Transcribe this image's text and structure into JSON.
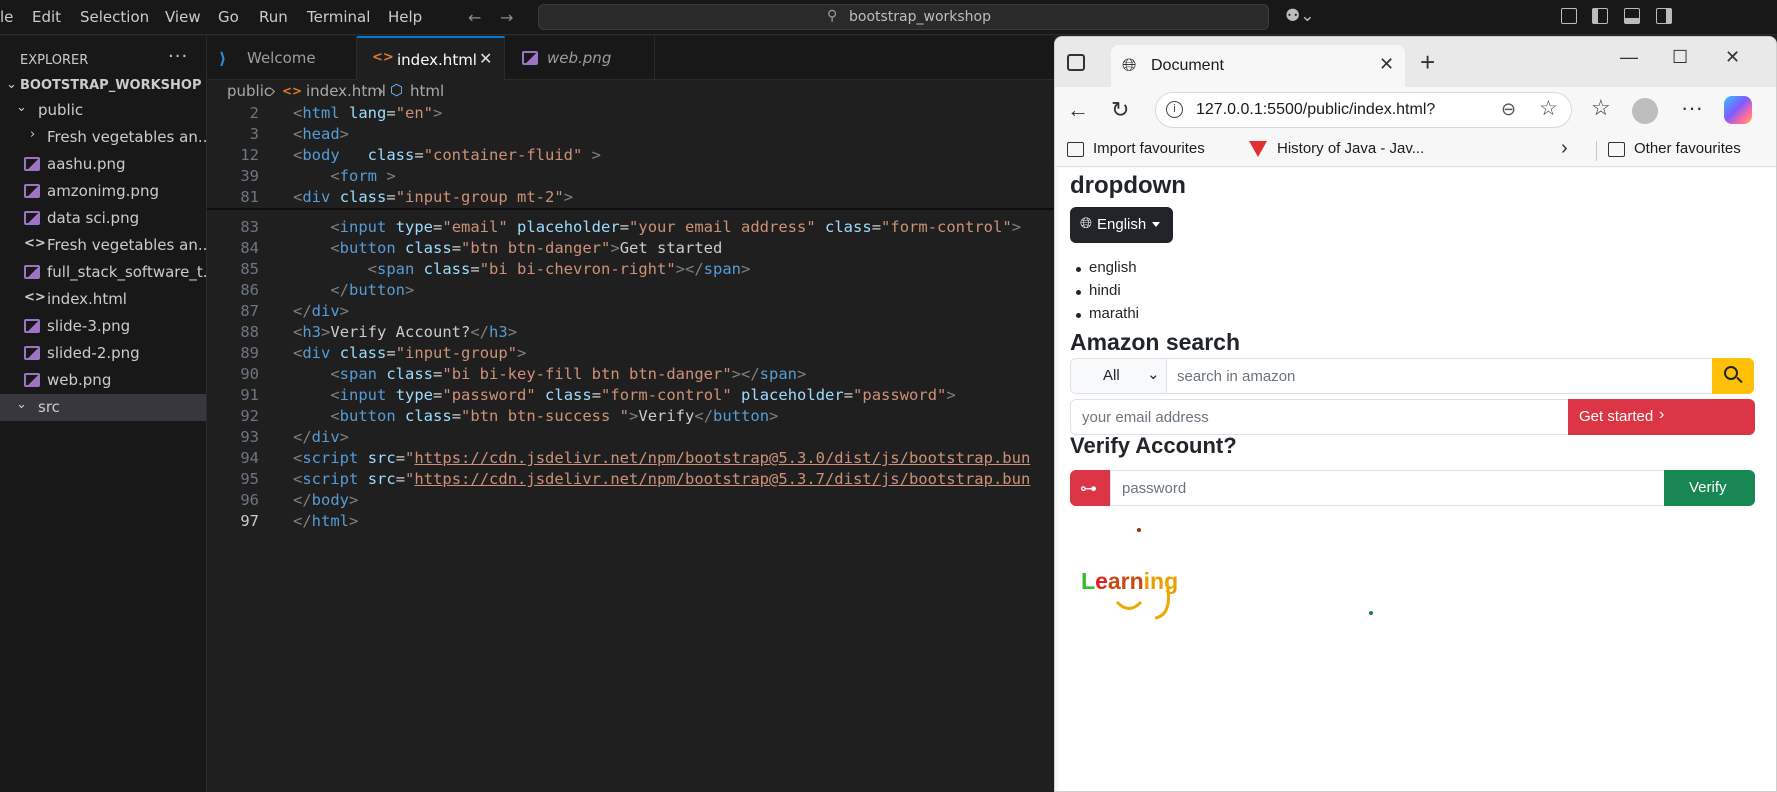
{
  "titlebar": {
    "menu": [
      "le",
      "Edit",
      "Selection",
      "View",
      "Go",
      "Run",
      "Terminal",
      "Help"
    ],
    "search_text": "bootstrap_workshop"
  },
  "explorer": {
    "title": "EXPLORER",
    "more": "···",
    "workspace": "BOOTSTRAP_WORKSHOP",
    "items": [
      {
        "label": "public",
        "kind": "folder-open"
      },
      {
        "label": "Fresh vegetables an...",
        "kind": "folder"
      },
      {
        "label": "aashu.png",
        "kind": "image"
      },
      {
        "label": "amzonimg.png",
        "kind": "image"
      },
      {
        "label": "data sci.png",
        "kind": "image"
      },
      {
        "label": "Fresh vegetables an...",
        "kind": "html"
      },
      {
        "label": "full_stack_software_t...",
        "kind": "image"
      },
      {
        "label": "index.html",
        "kind": "html"
      },
      {
        "label": "slide-3.png",
        "kind": "image"
      },
      {
        "label": "slided-2.png",
        "kind": "image"
      },
      {
        "label": "web.png",
        "kind": "image"
      },
      {
        "label": "src",
        "kind": "folder"
      }
    ]
  },
  "editor": {
    "tabs": [
      {
        "label": "Welcome"
      },
      {
        "label": "index.html"
      },
      {
        "label": "web.png"
      }
    ],
    "breadcrumb": [
      "public",
      "index.html",
      "html"
    ],
    "lines": [
      {
        "n": "2",
        "seg": [
          [
            "t",
            "<"
          ],
          [
            "n",
            "html"
          ],
          [
            "x",
            " "
          ],
          [
            "a",
            "lang"
          ],
          [
            "x",
            "="
          ],
          [
            "s",
            "\"en\""
          ],
          [
            "t",
            ">"
          ]
        ]
      },
      {
        "n": "3",
        "seg": [
          [
            "t",
            "<"
          ],
          [
            "n",
            "head"
          ],
          [
            "t",
            ">"
          ]
        ]
      },
      {
        "n": "12",
        "seg": [
          [
            "t",
            "<"
          ],
          [
            "n",
            "body"
          ],
          [
            "x",
            "   "
          ],
          [
            "a",
            "class"
          ],
          [
            "x",
            "="
          ],
          [
            "s",
            "\"container-fluid\""
          ],
          [
            "x",
            " "
          ],
          [
            "t",
            ">"
          ]
        ]
      },
      {
        "n": "39",
        "seg": [
          [
            "x",
            "    "
          ],
          [
            "t",
            "<"
          ],
          [
            "n",
            "form"
          ],
          [
            "x",
            " "
          ],
          [
            "t",
            ">"
          ]
        ]
      },
      {
        "n": "81",
        "seg": [
          [
            "t",
            "<"
          ],
          [
            "n",
            "div"
          ],
          [
            "x",
            " "
          ],
          [
            "a",
            "class"
          ],
          [
            "x",
            "="
          ],
          [
            "s",
            "\"input-group mt-2\""
          ],
          [
            "t",
            ">"
          ]
        ]
      },
      {
        "n": "83",
        "seg": [
          [
            "x",
            "    "
          ],
          [
            "t",
            "<"
          ],
          [
            "n",
            "input"
          ],
          [
            "x",
            " "
          ],
          [
            "a",
            "type"
          ],
          [
            "x",
            "="
          ],
          [
            "s",
            "\"email\""
          ],
          [
            "x",
            " "
          ],
          [
            "a",
            "placeholder"
          ],
          [
            "x",
            "="
          ],
          [
            "s",
            "\"your email address\""
          ],
          [
            "x",
            " "
          ],
          [
            "a",
            "class"
          ],
          [
            "x",
            "="
          ],
          [
            "s",
            "\"form-control\""
          ],
          [
            "t",
            ">"
          ]
        ]
      },
      {
        "n": "84",
        "seg": [
          [
            "x",
            "    "
          ],
          [
            "t",
            "<"
          ],
          [
            "n",
            "button"
          ],
          [
            "x",
            " "
          ],
          [
            "a",
            "class"
          ],
          [
            "x",
            "="
          ],
          [
            "s",
            "\"btn btn-danger\""
          ],
          [
            "t",
            ">"
          ],
          [
            "x",
            "Get started"
          ]
        ]
      },
      {
        "n": "85",
        "seg": [
          [
            "x",
            "        "
          ],
          [
            "t",
            "<"
          ],
          [
            "n",
            "span"
          ],
          [
            "x",
            " "
          ],
          [
            "a",
            "class"
          ],
          [
            "x",
            "="
          ],
          [
            "s",
            "\"bi bi-chevron-right\""
          ],
          [
            "t",
            "></"
          ],
          [
            "n",
            "span"
          ],
          [
            "t",
            ">"
          ]
        ]
      },
      {
        "n": "86",
        "seg": [
          [
            "x",
            "    "
          ],
          [
            "t",
            "</"
          ],
          [
            "n",
            "button"
          ],
          [
            "t",
            ">"
          ]
        ]
      },
      {
        "n": "87",
        "seg": [
          [
            "t",
            "</"
          ],
          [
            "n",
            "div"
          ],
          [
            "t",
            ">"
          ]
        ]
      },
      {
        "n": "88",
        "seg": [
          [
            "t",
            "<"
          ],
          [
            "n",
            "h3"
          ],
          [
            "t",
            ">"
          ],
          [
            "x",
            "Verify Account?"
          ],
          [
            "t",
            "</"
          ],
          [
            "n",
            "h3"
          ],
          [
            "t",
            ">"
          ]
        ]
      },
      {
        "n": "89",
        "seg": [
          [
            "t",
            "<"
          ],
          [
            "n",
            "div"
          ],
          [
            "x",
            " "
          ],
          [
            "a",
            "class"
          ],
          [
            "x",
            "="
          ],
          [
            "s",
            "\"input-group\""
          ],
          [
            "t",
            ">"
          ]
        ]
      },
      {
        "n": "90",
        "seg": [
          [
            "x",
            "    "
          ],
          [
            "t",
            "<"
          ],
          [
            "n",
            "span"
          ],
          [
            "x",
            " "
          ],
          [
            "a",
            "class"
          ],
          [
            "x",
            "="
          ],
          [
            "s",
            "\"bi bi-key-fill btn btn-danger\""
          ],
          [
            "t",
            "></"
          ],
          [
            "n",
            "span"
          ],
          [
            "t",
            ">"
          ]
        ]
      },
      {
        "n": "91",
        "seg": [
          [
            "x",
            "    "
          ],
          [
            "t",
            "<"
          ],
          [
            "n",
            "input"
          ],
          [
            "x",
            " "
          ],
          [
            "a",
            "type"
          ],
          [
            "x",
            "="
          ],
          [
            "s",
            "\"password\""
          ],
          [
            "x",
            " "
          ],
          [
            "a",
            "class"
          ],
          [
            "x",
            "="
          ],
          [
            "s",
            "\"form-control\""
          ],
          [
            "x",
            " "
          ],
          [
            "a",
            "placeholder"
          ],
          [
            "x",
            "="
          ],
          [
            "s",
            "\"password\""
          ],
          [
            "t",
            ">"
          ]
        ]
      },
      {
        "n": "92",
        "seg": [
          [
            "x",
            "    "
          ],
          [
            "t",
            "<"
          ],
          [
            "n",
            "button"
          ],
          [
            "x",
            " "
          ],
          [
            "a",
            "class"
          ],
          [
            "x",
            "="
          ],
          [
            "s",
            "\"btn btn-success \""
          ],
          [
            "t",
            ">"
          ],
          [
            "x",
            "Verify"
          ],
          [
            "t",
            "</"
          ],
          [
            "n",
            "button"
          ],
          [
            "t",
            ">"
          ]
        ]
      },
      {
        "n": "93",
        "seg": [
          [
            "t",
            "</"
          ],
          [
            "n",
            "div"
          ],
          [
            "t",
            ">"
          ]
        ]
      },
      {
        "n": "94",
        "seg": [
          [
            "t",
            "<"
          ],
          [
            "n",
            "script"
          ],
          [
            "x",
            " "
          ],
          [
            "a",
            "src"
          ],
          [
            "x",
            "="
          ],
          [
            "s",
            "\""
          ],
          [
            "su",
            "https://cdn.jsdelivr.net/npm/bootstrap@5.3.0/dist/js/bootstrap.bun"
          ]
        ]
      },
      {
        "n": "95",
        "seg": [
          [
            "t",
            "<"
          ],
          [
            "n",
            "script"
          ],
          [
            "x",
            " "
          ],
          [
            "a",
            "src"
          ],
          [
            "x",
            "="
          ],
          [
            "s",
            "\""
          ],
          [
            "su",
            "https://cdn.jsdelivr.net/npm/bootstrap@5.3.7/dist/js/bootstrap.bun"
          ]
        ]
      },
      {
        "n": "96",
        "seg": [
          [
            "t",
            "</"
          ],
          [
            "n",
            "body"
          ],
          [
            "t",
            ">"
          ]
        ]
      },
      {
        "n": "97",
        "seg": [
          [
            "t",
            "</"
          ],
          [
            "n",
            "html"
          ],
          [
            "t",
            ">"
          ]
        ]
      }
    ]
  },
  "browser": {
    "tab_title": "Document",
    "url": "127.0.0.1:5500/public/index.html?",
    "favorites": [
      "Import favourites",
      "History of Java - Jav...",
      "Other favourites"
    ]
  },
  "page": {
    "dropdown_heading": "dropdown",
    "dropdown_button": "English",
    "languages": [
      "english",
      "hindi",
      "marathi"
    ],
    "amazon_heading": "Amazon search",
    "category_selected": "All",
    "search_placeholder": "search in amazon",
    "email_placeholder": "your email address",
    "get_started": "Get started",
    "verify_heading": "Verify Account?",
    "password_placeholder": "password",
    "verify_button": "Verify",
    "doodle_text": "Learning"
  },
  "colors": {
    "vscode_bg": "#1f1f1f",
    "accent": "#0078d4",
    "danger": "#dc3545",
    "success": "#198754",
    "warning": "#ffc107",
    "dark": "#212529"
  }
}
